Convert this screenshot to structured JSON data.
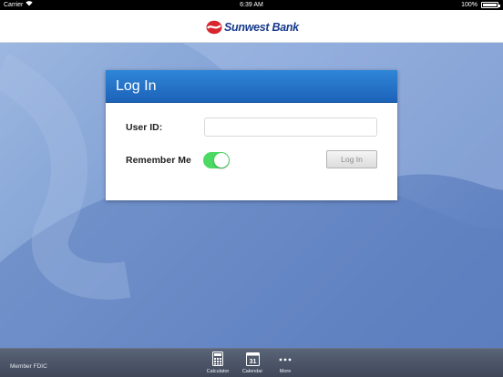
{
  "status_bar": {
    "carrier": "Carrier",
    "time": "6:39 AM",
    "battery": "100%"
  },
  "header": {
    "brand": "Sunwest Bank",
    "brand_color": "#173a8a",
    "logo_red": "#d7262e"
  },
  "login": {
    "title": "Log In",
    "user_id_label": "User ID:",
    "user_id_value": "",
    "remember_label": "Remember Me",
    "remember_on": true,
    "login_button": "Log In",
    "header_color": "#2f86d8",
    "toggle_color": "#4cd964"
  },
  "footer": {
    "member_text": "Member FDIC",
    "tabs": [
      {
        "label": "Calculator",
        "icon": "calculator-icon"
      },
      {
        "label": "Calendar",
        "icon": "calendar-icon",
        "day": "31"
      },
      {
        "label": "More",
        "icon": "more-icon"
      }
    ]
  }
}
